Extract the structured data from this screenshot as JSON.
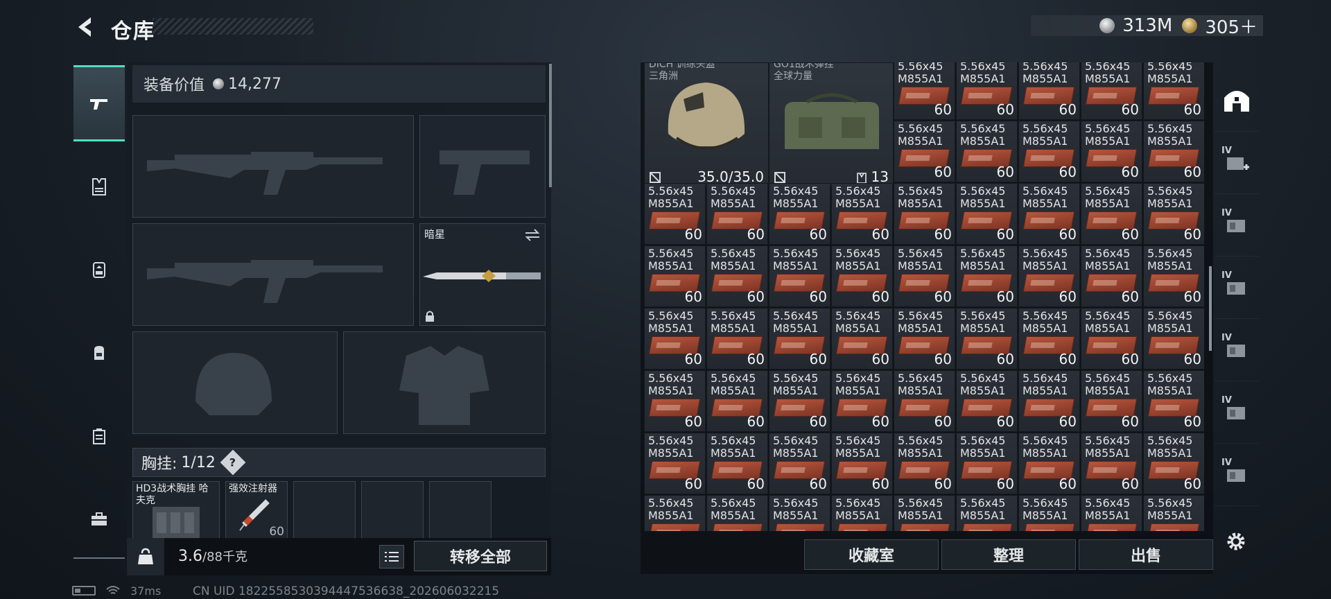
{
  "header": {
    "title": "仓库",
    "currency": [
      {
        "type": "silver",
        "value": "313M"
      },
      {
        "type": "gold",
        "value": "305＋"
      }
    ]
  },
  "left_tabs": [
    {
      "name": "tab-weapons",
      "icon": "pistol-icon",
      "active": true
    },
    {
      "name": "tab-armor",
      "icon": "vest-icon",
      "active": false
    },
    {
      "name": "tab-chest-rig",
      "icon": "chest-rig-icon",
      "active": false
    },
    {
      "name": "tab-backpack",
      "icon": "backpack-icon",
      "active": false
    },
    {
      "name": "tab-case",
      "icon": "case-icon",
      "active": false
    },
    {
      "name": "tab-toolbox",
      "icon": "toolbox-icon",
      "active": false
    }
  ],
  "equipment": {
    "value_label": "装备价值",
    "value": "14,277",
    "knife_label": "暗星",
    "chest_label": "胸挂:",
    "chest_count": "1/12",
    "help": "?",
    "chest_slots": [
      {
        "name": "HD3战术胸挂 哈夫克",
        "count": ""
      },
      {
        "name": "强效注射器",
        "count": "60"
      },
      {
        "name": "",
        "count": ""
      },
      {
        "name": "",
        "count": ""
      },
      {
        "name": "",
        "count": ""
      }
    ],
    "weight_current": "3.6",
    "weight_max": "/88千克",
    "transfer_all": "转移全部"
  },
  "storage": {
    "helmet": {
      "name_lines": [
        "DICH 训练头盔",
        "三角洲"
      ],
      "durability": "35.0/35.0"
    },
    "bag": {
      "name_lines": [
        "GO1战术弹挂",
        "全球力量"
      ],
      "count": "13"
    },
    "ammo_name_1": "5.56x45",
    "ammo_name_2": "M855A1",
    "ammo_count": "60",
    "buttons": {
      "collection": "收藏室",
      "sort": "整理",
      "sell": "出售"
    }
  },
  "right_icons": [
    "home-icon",
    "add-container-icon",
    "container-icon",
    "container-icon",
    "container-icon",
    "container-icon",
    "container-icon"
  ],
  "right_icon_label": "IV",
  "status": {
    "ping": "37ms",
    "uid": "CN UID 1822558530394447536638_202606032215"
  },
  "colors": {
    "accent": "#4fe0c2",
    "ammo_box": "#b7563e"
  }
}
